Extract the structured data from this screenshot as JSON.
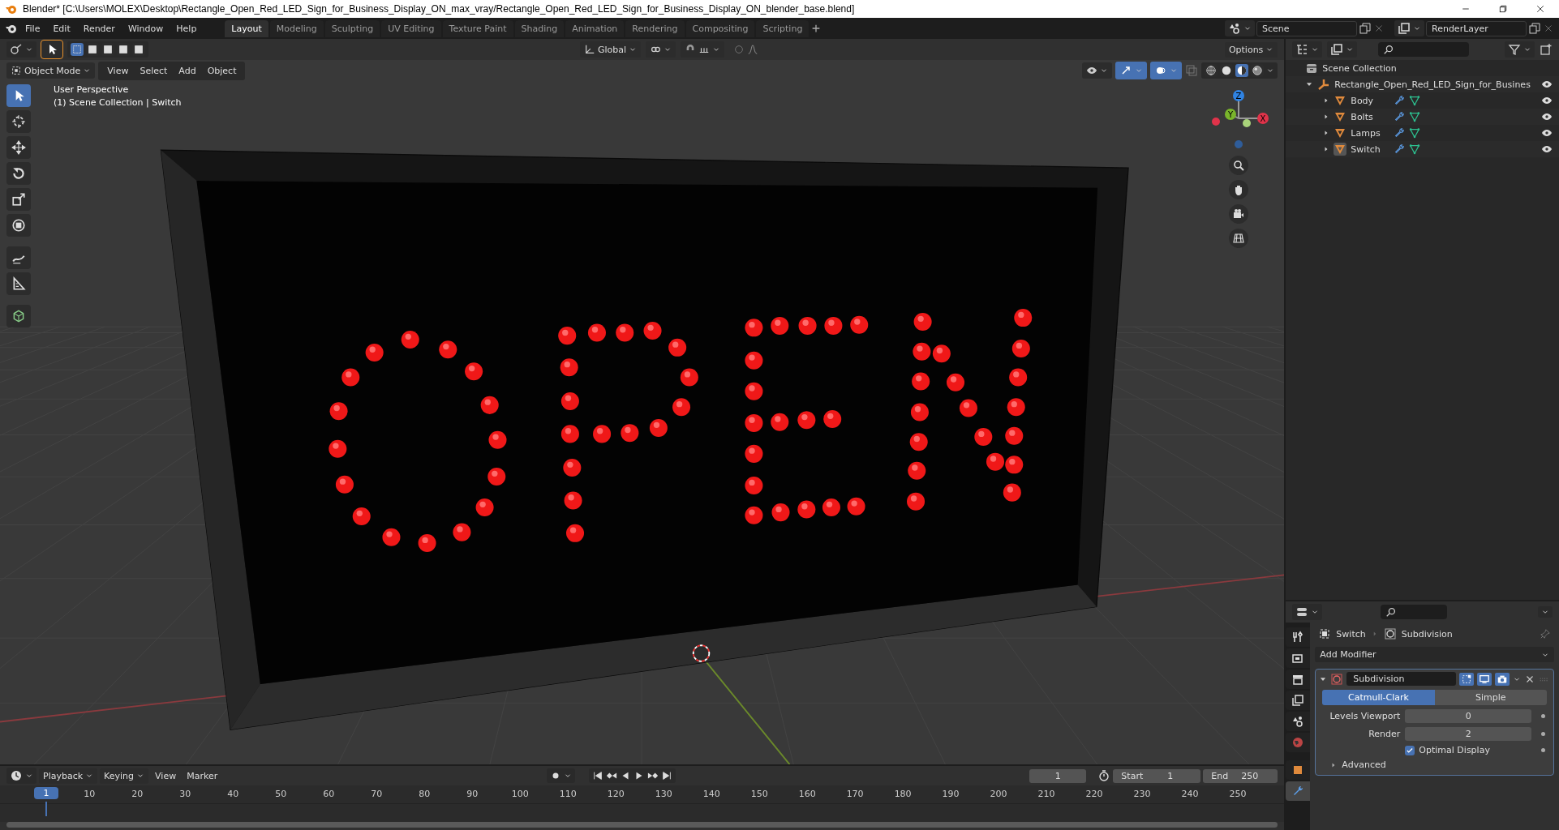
{
  "window": {
    "title": "Blender* [C:\\Users\\MOLEX\\Desktop\\Rectangle_Open_Red_LED_Sign_for_Business_Display_ON_max_vray/Rectangle_Open_Red_LED_Sign_for_Business_Display_ON_blender_base.blend]"
  },
  "menu_bar": {
    "menus": [
      "File",
      "Edit",
      "Render",
      "Window",
      "Help"
    ]
  },
  "workspaces": [
    {
      "label": "Layout",
      "selected": true
    },
    {
      "label": "Modeling",
      "selected": false
    },
    {
      "label": "Sculpting",
      "selected": false
    },
    {
      "label": "UV Editing",
      "selected": false
    },
    {
      "label": "Texture Paint",
      "selected": false
    },
    {
      "label": "Shading",
      "selected": false
    },
    {
      "label": "Animation",
      "selected": false
    },
    {
      "label": "Rendering",
      "selected": false
    },
    {
      "label": "Compositing",
      "selected": false
    },
    {
      "label": "Scripting",
      "selected": false
    }
  ],
  "scene": {
    "scene_name": "Scene",
    "view_layer": "RenderLayer"
  },
  "viewport": {
    "selection_modes": [
      {
        "selected": true
      },
      {
        "selected": false
      },
      {
        "selected": false
      },
      {
        "selected": false
      },
      {
        "selected": false
      }
    ],
    "orientation": "Global",
    "snap": false,
    "proportional_edit": false,
    "gizmos": true,
    "overlays": true,
    "options": "Options",
    "mode": "Object Mode",
    "menus": [
      "View",
      "Select",
      "Add",
      "Object"
    ],
    "shading_modes": [
      {
        "kind": "wireframe",
        "selected": false
      },
      {
        "kind": "solid",
        "selected": false
      },
      {
        "kind": "material",
        "selected": true
      },
      {
        "kind": "rendered",
        "selected": false
      }
    ],
    "tools": [
      {
        "kind": "select",
        "selected": true
      },
      {
        "kind": "cursor",
        "selected": false
      },
      {
        "kind": "move",
        "selected": false
      },
      {
        "kind": "rotate",
        "selected": false
      },
      {
        "kind": "scale",
        "selected": false
      },
      {
        "kind": "transform",
        "selected": false
      },
      {
        "kind": "annotate",
        "selected": false
      },
      {
        "kind": "measure",
        "selected": false
      },
      {
        "kind": "add-cube",
        "selected": false
      }
    ],
    "info": [
      "User Perspective",
      "(1) Scene Collection | Switch"
    ],
    "gizmo_axes": [
      "Z",
      "Y",
      "X"
    ]
  },
  "outliner": {
    "root": "Scene Collection",
    "items": [
      {
        "label": "Rectangle_Open_Red_LED_Sign_for_Busines",
        "expanded": true,
        "children": [
          {
            "label": "Body",
            "expanded": false,
            "selected": false
          },
          {
            "label": "Bolts",
            "expanded": false,
            "selected": false
          },
          {
            "label": "Lamps",
            "expanded": false,
            "selected": false
          },
          {
            "label": "Switch",
            "expanded": false,
            "selected": true
          }
        ]
      }
    ]
  },
  "properties": {
    "tabs": [
      {
        "kind": "tool",
        "selected": false
      },
      {
        "kind": "render",
        "selected": false
      },
      {
        "kind": "output",
        "selected": false
      },
      {
        "kind": "view-layer",
        "selected": false
      },
      {
        "kind": "scene",
        "selected": false
      },
      {
        "kind": "world",
        "selected": false
      },
      {
        "kind": "object",
        "selected": false
      },
      {
        "kind": "modifiers",
        "selected": true
      }
    ],
    "breadcrumb": [
      "Switch",
      "Subdivision"
    ],
    "add_modifier": "Add Modifier",
    "modifier": {
      "name": "Subdivision",
      "expanded": true,
      "methods": [
        {
          "label": "Catmull-Clark",
          "selected": true
        },
        {
          "label": "Simple",
          "selected": false
        }
      ],
      "fields": [
        {
          "label": "Levels Viewport",
          "value": "0"
        },
        {
          "label": "Render",
          "value": "2"
        }
      ],
      "optimal_display": {
        "label": "Optimal Display",
        "checked": true
      },
      "advanced": {
        "label": "Advanced",
        "expanded": false
      }
    }
  },
  "timeline": {
    "menus": [
      {
        "label": "Playback",
        "dropdown": true
      },
      {
        "label": "Keying",
        "dropdown": true
      },
      {
        "label": "View",
        "dropdown": false
      },
      {
        "label": "Marker",
        "dropdown": false
      }
    ],
    "auto_keying": false,
    "current_frame": "1",
    "start_label": "Start",
    "start": "1",
    "end_label": "End",
    "end": "250",
    "playhead": "1",
    "ticks": [
      "10",
      "20",
      "30",
      "40",
      "50",
      "60",
      "70",
      "80",
      "90",
      "100",
      "110",
      "120",
      "130",
      "140",
      "150",
      "160",
      "170",
      "180",
      "190",
      "200",
      "210",
      "220",
      "230",
      "240",
      "250"
    ]
  }
}
